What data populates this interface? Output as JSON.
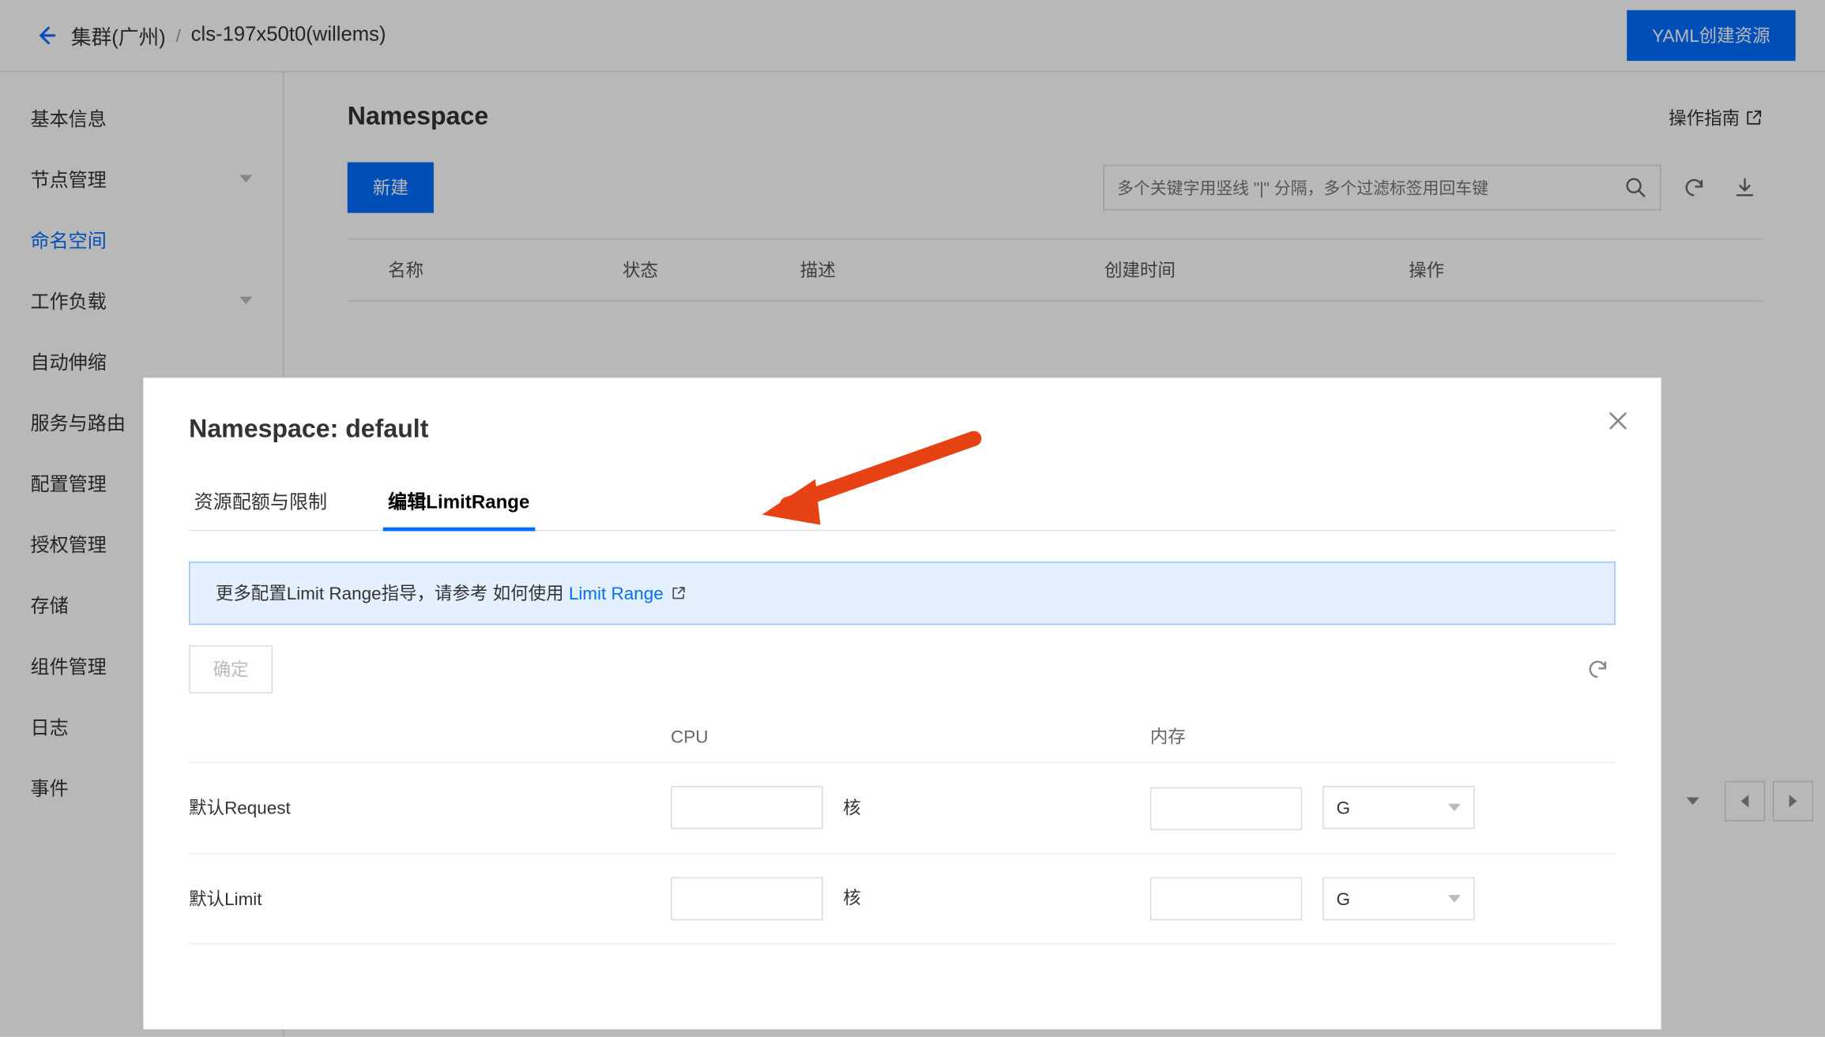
{
  "breadcrumb": {
    "back_aria": "返回",
    "cluster": "集群(广州)",
    "id": "cls-197x50t0(willems)"
  },
  "header": {
    "yaml_button": "YAML创建资源"
  },
  "sidebar": {
    "items": [
      {
        "label": "基本信息",
        "expandable": false
      },
      {
        "label": "节点管理",
        "expandable": true
      },
      {
        "label": "命名空间",
        "expandable": false,
        "active": true
      },
      {
        "label": "工作负载",
        "expandable": true
      },
      {
        "label": "自动伸缩",
        "expandable": false
      },
      {
        "label": "服务与路由",
        "expandable": false
      },
      {
        "label": "配置管理",
        "expandable": false
      },
      {
        "label": "授权管理",
        "expandable": false
      },
      {
        "label": "存储",
        "expandable": false
      },
      {
        "label": "组件管理",
        "expandable": false
      },
      {
        "label": "日志",
        "expandable": false
      },
      {
        "label": "事件",
        "expandable": false
      }
    ]
  },
  "page": {
    "title": "Namespace",
    "guide": "操作指南",
    "create_button": "新建",
    "search_placeholder": "多个关键字用竖线 \"|\" 分隔，多个过滤标签用回车键",
    "columns": {
      "name": "名称",
      "status": "状态",
      "desc": "描述",
      "time": "创建时间",
      "op": "操作"
    }
  },
  "modal": {
    "title": "Namespace: default",
    "tabs": {
      "quota": "资源配额与限制",
      "limit": "编辑LimitRange"
    },
    "info_prefix": "更多配置Limit Range指导，请参考 如何使用",
    "info_link": "Limit Range",
    "confirm": "确定",
    "columns": {
      "cpu": "CPU",
      "mem": "内存"
    },
    "rows": {
      "req": "默认Request",
      "lim": "默认Limit"
    },
    "unit_core": "核",
    "mem_unit_options": [
      "G"
    ],
    "mem_unit_selected": "G"
  }
}
